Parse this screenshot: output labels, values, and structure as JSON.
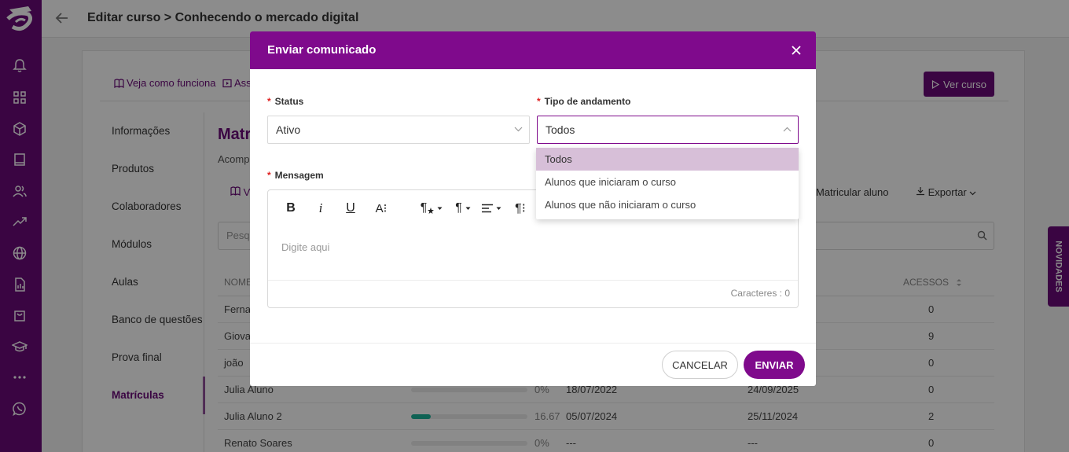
{
  "header": {
    "title": "Editar curso > Conhecendo o mercado digital"
  },
  "top_links": {
    "how_it_works": "Veja como funciona",
    "second": "Ass",
    "view_course": "Ver curso"
  },
  "side_menu": [
    "Informações",
    "Produtos",
    "Colaboradores",
    "Módulos",
    "Aulas",
    "Banco de questões",
    "Prova final",
    "Matrículas"
  ],
  "section": {
    "title": "Matr",
    "subtitle": "Acompa",
    "link": "V",
    "enroll": "Matricular aluno",
    "export": "Exportar",
    "search_placeholder": "Pesq"
  },
  "table": {
    "headers": {
      "name": "NOME",
      "access": "ACESSOS"
    },
    "rows": [
      {
        "name": "Fernan",
        "progress": null,
        "pct": "",
        "start": "",
        "end": "",
        "access": "0"
      },
      {
        "name": "Giovan",
        "progress": null,
        "pct": "",
        "start": "",
        "end": "",
        "access": "9"
      },
      {
        "name": "joão",
        "progress": null,
        "pct": "",
        "start": "",
        "end": "",
        "access": "0"
      },
      {
        "name": "Julia Aluno",
        "progress": 0,
        "pct": "0%",
        "start": "18/07/2022",
        "end": "24/09/2025",
        "access": "0"
      },
      {
        "name": "Julia Aluno 2",
        "progress": 16.67,
        "pct": "16.67",
        "start": "05/07/2024",
        "end": "25/11/2024",
        "access": "2"
      },
      {
        "name": "Renato Soares",
        "progress": 0,
        "pct": "0%",
        "start": "---",
        "end": "---",
        "access": "0"
      }
    ]
  },
  "novidades": "NOVIDADES",
  "modal": {
    "title": "Enviar comunicado",
    "status_label": "Status",
    "status_value": "Ativo",
    "tipo_label": "Tipo de andamento",
    "tipo_value": "Todos",
    "message_label": "Mensagem",
    "placeholder": "Digite aqui",
    "chars": "Caracteres : 0",
    "cancel": "CANCELAR",
    "send": "ENVIAR",
    "toolbar": {
      "bold": "B",
      "italic": "i",
      "underline": "U",
      "size": "A⁝",
      "para": "¶",
      "para2": "¶",
      "para3": "¶⁝"
    }
  },
  "dropdown": {
    "options": [
      "Todos",
      "Alunos que iniciaram o curso",
      "Alunos que não iniciaram o curso"
    ],
    "selected": "Todos"
  },
  "colors": {
    "brand": "#7f0a8c",
    "nav": "#6a0a78",
    "progress": "#1cb39a",
    "selected_option": "#d7bfd8"
  }
}
